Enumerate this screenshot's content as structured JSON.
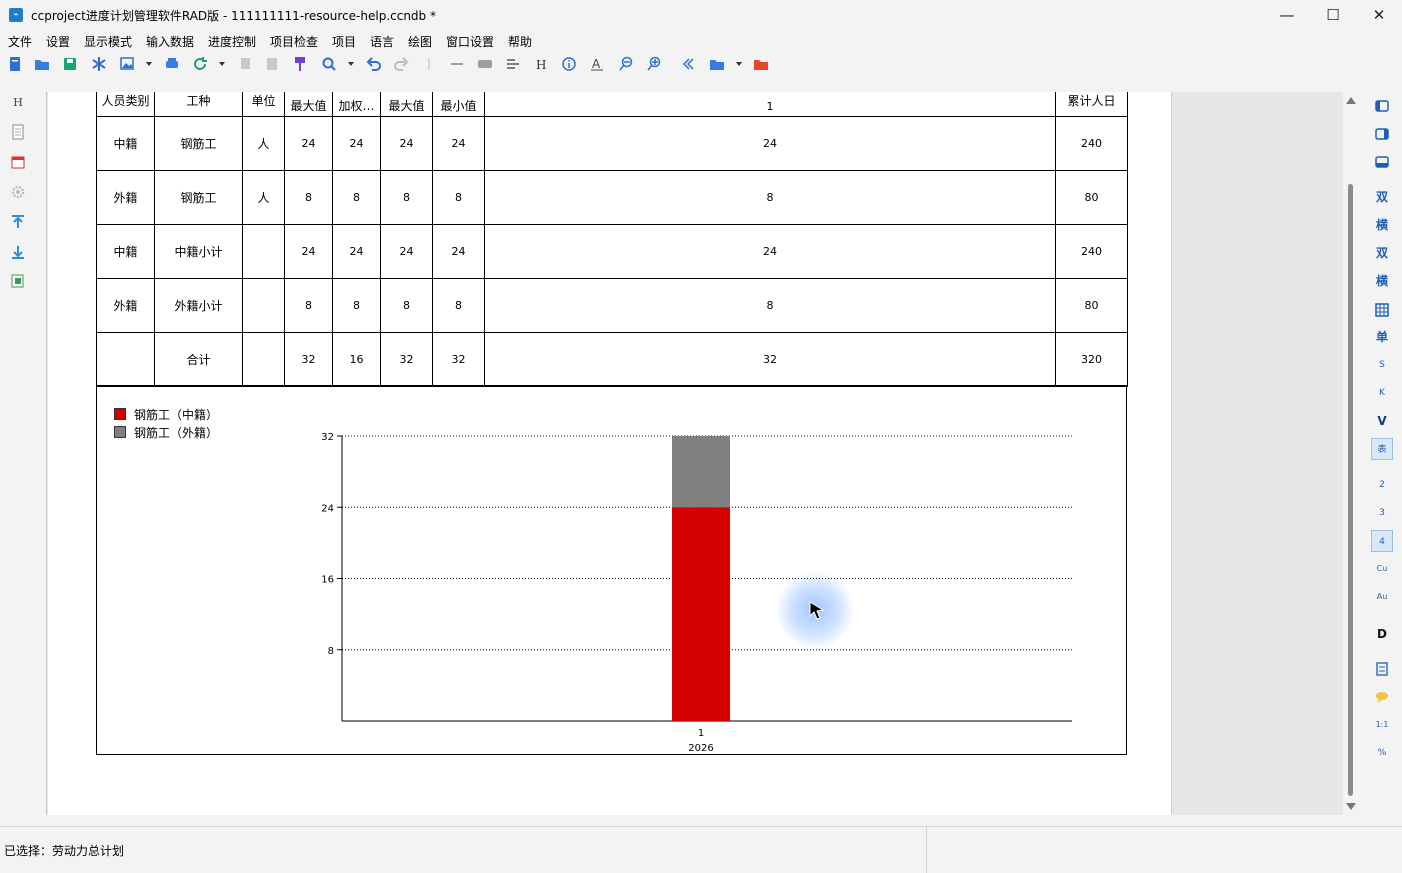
{
  "window": {
    "title": "ccproject进度计划管理软件RAD版 - 111111111-resource-help.ccndb *",
    "minimize": "—",
    "maximize": "☐",
    "close": "✕"
  },
  "menu": [
    "文件",
    "设置",
    "显示模式",
    "输入数据",
    "进度控制",
    "项目检查",
    "项目",
    "语言",
    "绘图",
    "窗口设置",
    "帮助"
  ],
  "left_sidebar": {
    "top_label": "H"
  },
  "table": {
    "headers": {
      "person_type": "人员类别",
      "work_type": "工种",
      "unit": "单位",
      "max1": "最大值",
      "weighted": "加权…",
      "max2": "最大值",
      "min": "最小值",
      "period": "1",
      "cumulative": "累计人日"
    },
    "rows": [
      {
        "type": "中籍",
        "work": "钢筋工",
        "unit": "人",
        "max1": "24",
        "weighted": "24",
        "max2": "24",
        "min": "24",
        "period": "24",
        "cumulative": "240"
      },
      {
        "type": "外籍",
        "work": "钢筋工",
        "unit": "人",
        "max1": "8",
        "weighted": "8",
        "max2": "8",
        "min": "8",
        "period": "8",
        "cumulative": "80"
      },
      {
        "type": "中籍",
        "work": "中籍小计",
        "unit": "",
        "max1": "24",
        "weighted": "24",
        "max2": "24",
        "min": "24",
        "period": "24",
        "cumulative": "240"
      },
      {
        "type": "外籍",
        "work": "外籍小计",
        "unit": "",
        "max1": "8",
        "weighted": "8",
        "max2": "8",
        "min": "8",
        "period": "8",
        "cumulative": "80"
      },
      {
        "type": "",
        "work": "合计",
        "unit": "",
        "max1": "32",
        "weighted": "16",
        "max2": "32",
        "min": "32",
        "period": "32",
        "cumulative": "320"
      }
    ]
  },
  "chart_data": {
    "type": "bar",
    "stacked": true,
    "categories": [
      "1"
    ],
    "x_sublabel": "2026",
    "series": [
      {
        "name": "钢筋工（中籍）",
        "values": [
          24
        ],
        "color": "#d40000"
      },
      {
        "name": "钢筋工（外籍）",
        "values": [
          8
        ],
        "color": "#808080"
      }
    ],
    "yticks": [
      8,
      16,
      24,
      32
    ],
    "ylim": [
      0,
      32
    ],
    "grid": true,
    "legend_position": "top-left"
  },
  "right_panel": [
    "双",
    "横",
    "双",
    "横",
    "单",
    "S",
    "K",
    "V",
    "表",
    "2",
    "3",
    "4",
    "Cu",
    "Au",
    "D",
    "1:1",
    "%"
  ],
  "status": {
    "text": "已选择：劳动力总计划"
  }
}
